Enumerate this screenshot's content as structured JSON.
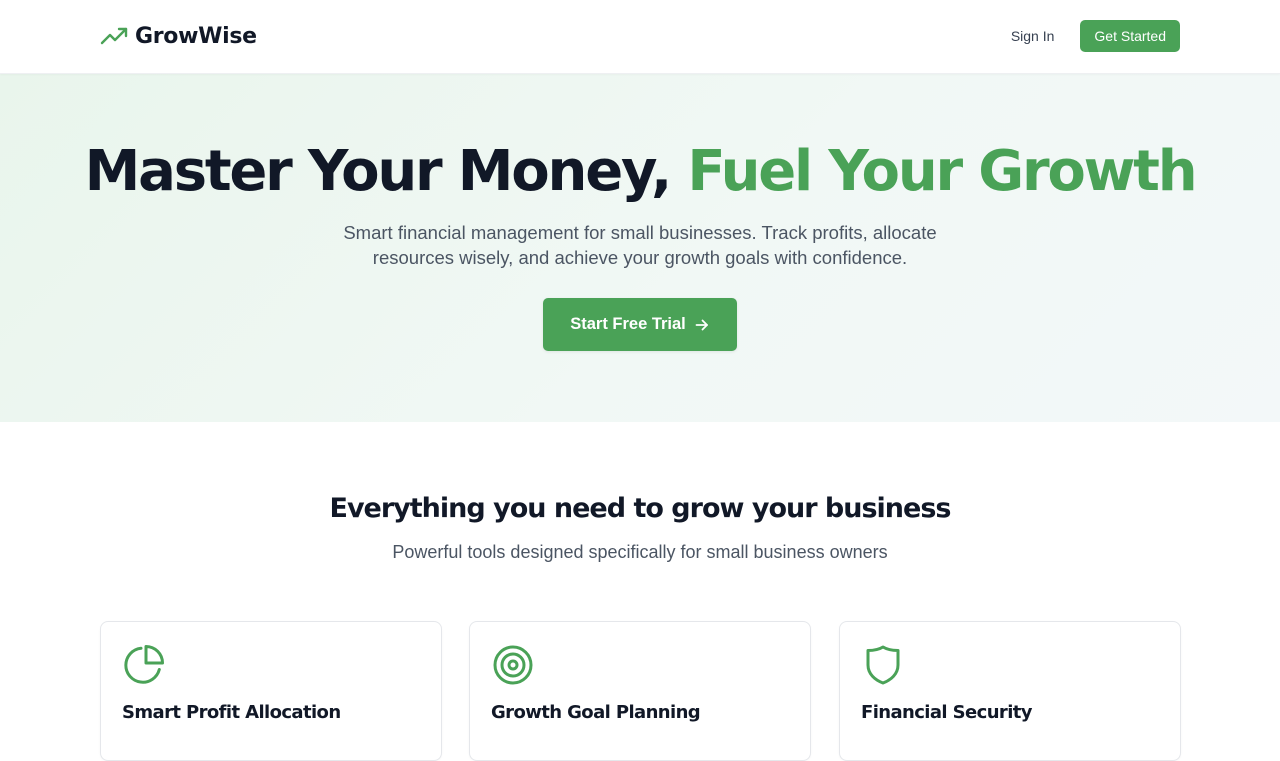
{
  "header": {
    "brand_name": "GrowWise",
    "brand_icon": "trending-up-icon",
    "sign_in_label": "Sign In",
    "get_started_label": "Get Started"
  },
  "hero": {
    "title_part1": "Master Your Money, ",
    "title_part2": "Fuel Your Growth",
    "subtitle": "Smart financial management for small businesses. Track profits, allocate resources wisely, and achieve your growth goals with confidence.",
    "cta_label": "Start Free Trial",
    "cta_icon": "arrow-right-icon"
  },
  "features": {
    "title": "Everything you need to grow your business",
    "subtitle": "Powerful tools designed specifically for small business owners",
    "cards": [
      {
        "icon": "pie-chart-icon",
        "title": "Smart Profit Allocation"
      },
      {
        "icon": "target-icon",
        "title": "Growth Goal Planning"
      },
      {
        "icon": "shield-icon",
        "title": "Financial Security"
      }
    ]
  },
  "colors": {
    "accent": "#4aa257",
    "heading": "#111827",
    "body_text": "#4b5563"
  }
}
